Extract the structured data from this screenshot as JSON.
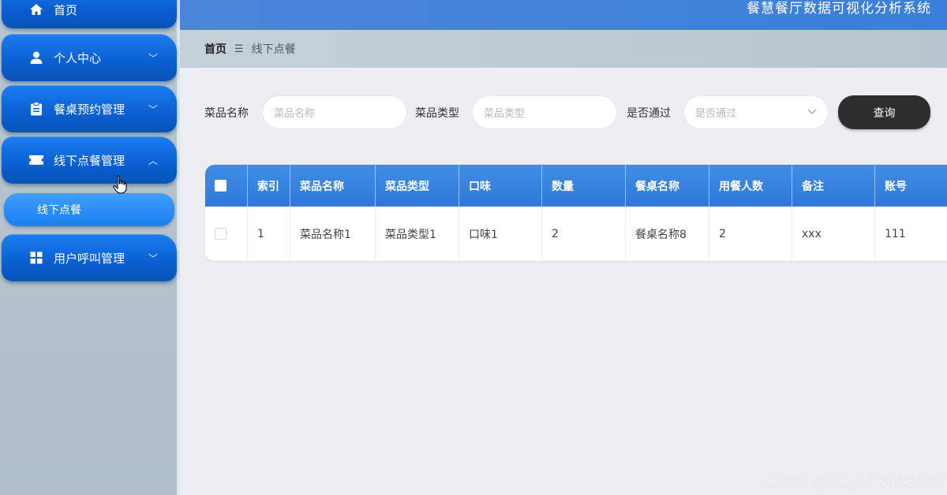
{
  "header": {
    "system_title": "餐慧餐厅数据可视化分析系统"
  },
  "sidebar": {
    "items": [
      {
        "label": "首页",
        "icon": "home-icon"
      },
      {
        "label": "个人中心",
        "icon": "user-icon",
        "chevron": "﹀"
      },
      {
        "label": "餐桌预约管理",
        "icon": "clipboard-icon",
        "chevron": "﹀"
      },
      {
        "label": "线下点餐管理",
        "icon": "ticket-icon",
        "chevron": "︿"
      },
      {
        "label": "用户呼叫管理",
        "icon": "grid-icon",
        "chevron": "﹀"
      }
    ],
    "submenu": {
      "label": "线下点餐"
    }
  },
  "breadcrumb": {
    "home": "首页",
    "separator": "☰",
    "current": "线下点餐"
  },
  "filters": {
    "dish_name": {
      "label": "菜品名称",
      "placeholder": "菜品名称"
    },
    "dish_type": {
      "label": "菜品类型",
      "placeholder": "菜品类型"
    },
    "approved": {
      "label": "是否通过",
      "placeholder": "是否通过"
    },
    "search_button": "查询"
  },
  "table": {
    "headers": [
      "索引",
      "菜品名称",
      "菜品类型",
      "口味",
      "数量",
      "餐桌名称",
      "用餐人数",
      "备注",
      "账号"
    ],
    "rows": [
      [
        "1",
        "菜品名称1",
        "菜品类型1",
        "口味1",
        "2",
        "餐桌名称8",
        "2",
        "xxx",
        "111"
      ]
    ]
  },
  "watermark": "CSDN @QQ_188083800",
  "colors": {
    "primary": "#1b7ef0",
    "header_bar": "#3a7fd9",
    "search_button": "#2e2e2e"
  }
}
